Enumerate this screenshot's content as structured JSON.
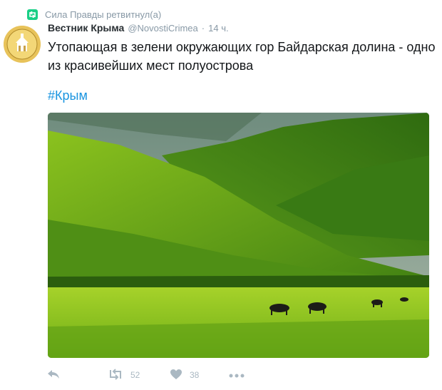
{
  "retweet": {
    "text": "Сила Правды ретвитнул(а)",
    "icon": "retweet-icon",
    "color": "#19cf86"
  },
  "tweet": {
    "author_name": "Вестник Крыма",
    "author_handle": "@NovostiCrimea",
    "separator": "·",
    "time": "14 ч.",
    "text": "Утопающая в зелени окружающих гор Байдарская долина - одно из красивейших мест полуострова",
    "hashtag": "#Крым",
    "hashtag_color": "#1b95e0"
  },
  "actions": {
    "reply_icon": "reply-icon",
    "retweet_icon": "retweet-icon",
    "retweet_count": "52",
    "like_icon": "heart-icon",
    "like_count": "38",
    "more_icon": "more-dots-icon"
  }
}
